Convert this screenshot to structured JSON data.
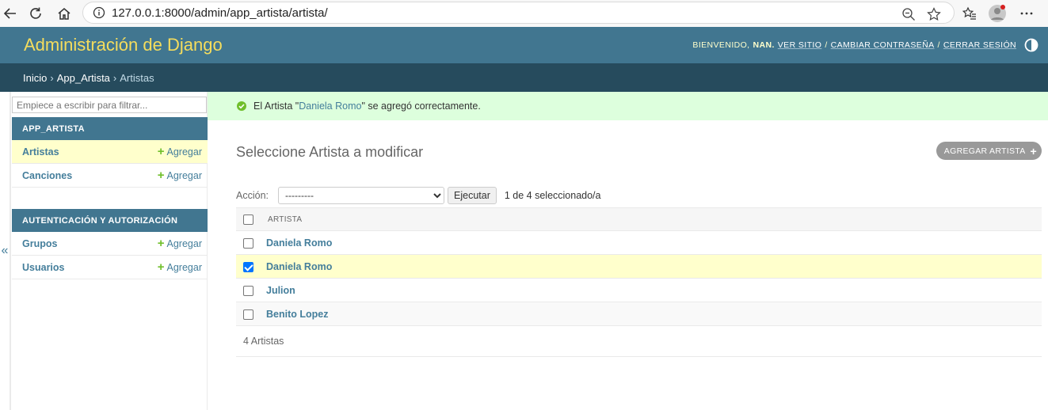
{
  "browser": {
    "url": "127.0.0.1:8000/admin/app_artista/artista/"
  },
  "header": {
    "brand": "Administración de Django",
    "welcome": "BIENVENIDO,",
    "username": "NAN.",
    "view_site": "VER SITIO",
    "change_password": "CAMBIAR CONTRASEÑA",
    "logout": "CERRAR SESIÓN",
    "separator": "/"
  },
  "breadcrumbs": {
    "home": "Inicio",
    "app": "App_Artista",
    "current": "Artistas",
    "chevron": "›"
  },
  "sidebar": {
    "toggle": "«",
    "filter_placeholder": "Empiece a escribir para filtrar...",
    "modules": [
      {
        "caption": "APP_ARTISTA",
        "rows": [
          {
            "label": "Artistas",
            "add": "Agregar",
            "current": true
          },
          {
            "label": "Canciones",
            "add": "Agregar",
            "current": false
          }
        ]
      },
      {
        "caption": "AUTENTICACIÓN Y AUTORIZACIÓN",
        "rows": [
          {
            "label": "Grupos",
            "add": "Agregar",
            "current": false
          },
          {
            "label": "Usuarios",
            "add": "Agregar",
            "current": false
          }
        ]
      }
    ]
  },
  "messages": {
    "success_prefix": "El Artista \"",
    "success_link": "Daniela Romo",
    "success_suffix": "\" se agregó correctamente."
  },
  "content": {
    "title": "Seleccione Artista a modificar",
    "add_button": "AGREGAR ARTISTA",
    "action_label": "Acción:",
    "action_selected": "---------",
    "go_button": "Ejecutar",
    "counter": "1 de 4 seleccionado/a",
    "column_header": "ARTISTA",
    "rows": [
      {
        "name": "Daniela Romo",
        "checked": false
      },
      {
        "name": "Daniela Romo",
        "checked": true
      },
      {
        "name": "Julion",
        "checked": false
      },
      {
        "name": "Benito Lopez",
        "checked": false
      }
    ],
    "total": "4 Artistas"
  },
  "colors": {
    "header_bg": "#417690",
    "brand": "#f5dd5d",
    "breadcrumbs_bg": "#264b5d",
    "success_bg": "#ddffdd",
    "selected_row": "#ffffcc",
    "link": "#447e9b"
  }
}
